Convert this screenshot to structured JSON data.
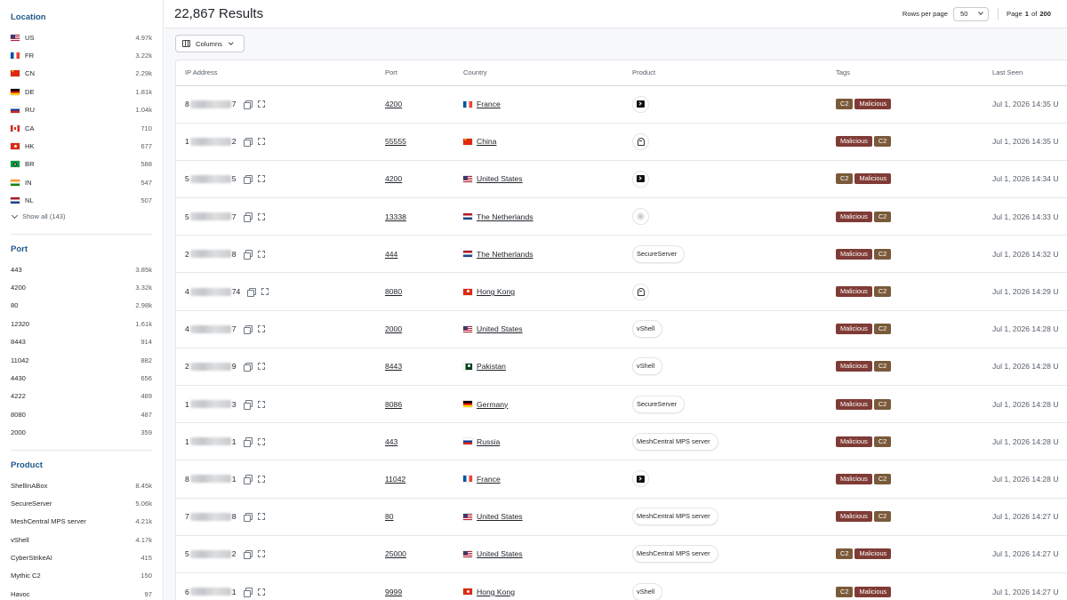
{
  "sidebar": {
    "location": {
      "title": "Location",
      "items": [
        {
          "flag": "us",
          "label": "US",
          "count": "4.97k"
        },
        {
          "flag": "fr",
          "label": "FR",
          "count": "3.22k"
        },
        {
          "flag": "cn",
          "label": "CN",
          "count": "2.29k"
        },
        {
          "flag": "de",
          "label": "DE",
          "count": "1.81k"
        },
        {
          "flag": "ru",
          "label": "RU",
          "count": "1.04k"
        },
        {
          "flag": "ca",
          "label": "CA",
          "count": "710"
        },
        {
          "flag": "hk",
          "label": "HK",
          "count": "677"
        },
        {
          "flag": "br",
          "label": "BR",
          "count": "588"
        },
        {
          "flag": "in",
          "label": "IN",
          "count": "547"
        },
        {
          "flag": "nl",
          "label": "NL",
          "count": "507"
        }
      ],
      "show_all": "Show all (143)"
    },
    "port": {
      "title": "Port",
      "items": [
        {
          "label": "443",
          "count": "3.85k"
        },
        {
          "label": "4200",
          "count": "3.32k"
        },
        {
          "label": "80",
          "count": "2.98k"
        },
        {
          "label": "12320",
          "count": "1.61k"
        },
        {
          "label": "8443",
          "count": "914"
        },
        {
          "label": "11042",
          "count": "882"
        },
        {
          "label": "4430",
          "count": "656"
        },
        {
          "label": "4222",
          "count": "489"
        },
        {
          "label": "8080",
          "count": "487"
        },
        {
          "label": "2000",
          "count": "359"
        }
      ]
    },
    "product": {
      "title": "Product",
      "items": [
        {
          "label": "ShellInABox",
          "count": "8.45k"
        },
        {
          "label": "SecureServer",
          "count": "5.06k"
        },
        {
          "label": "MeshCentral MPS server",
          "count": "4.21k"
        },
        {
          "label": "vShell",
          "count": "4.17k"
        },
        {
          "label": "CyberStrikeAI",
          "count": "415"
        },
        {
          "label": "Mythic C2",
          "count": "150"
        },
        {
          "label": "Havoc",
          "count": "97"
        }
      ]
    }
  },
  "header": {
    "results_title": "22,867 Results",
    "rows_per_page_label": "Rows per page",
    "rows_per_page_value": "50",
    "page_label": "Page",
    "page_current": "1",
    "page_of": "of",
    "page_total": "200"
  },
  "toolbar": {
    "columns_label": "Columns"
  },
  "table": {
    "columns": [
      "IP Address",
      "Port",
      "Country",
      "Product",
      "Tags",
      "Last Seen"
    ],
    "rows": [
      {
        "ip_start": "8",
        "ip_end": "7",
        "port": "4200",
        "flag": "fr",
        "country": "France",
        "product": "",
        "product_icon": "terminal-icon",
        "tags": [
          "C2",
          "Malicious"
        ],
        "last_seen": "Jul 1, 2026 14:35 U"
      },
      {
        "ip_start": "1",
        "ip_end": "2",
        "port": "55555",
        "flag": "cn",
        "country": "China",
        "product": "",
        "product_icon": "ghost-icon",
        "tags": [
          "Malicious",
          "C2"
        ],
        "last_seen": "Jul 1, 2026 14:35 U"
      },
      {
        "ip_start": "5",
        "ip_end": "5",
        "port": "4200",
        "flag": "us",
        "country": "United States",
        "product": "",
        "product_icon": "terminal-icon",
        "tags": [
          "C2",
          "Malicious"
        ],
        "last_seen": "Jul 1, 2026 14:34 U"
      },
      {
        "ip_start": "5",
        "ip_end": "7",
        "port": "13338",
        "flag": "nl",
        "country": "The Netherlands",
        "product": "",
        "product_icon": "bug-icon",
        "tags": [
          "Malicious",
          "C2"
        ],
        "last_seen": "Jul 1, 2026 14:33 U"
      },
      {
        "ip_start": "2",
        "ip_end": "8",
        "port": "444",
        "flag": "nl",
        "country": "The Netherlands",
        "product": "SecureServer",
        "product_icon": "",
        "tags": [
          "Malicious",
          "C2"
        ],
        "last_seen": "Jul 1, 2026 14:32 U"
      },
      {
        "ip_start": "4",
        "ip_end": "74",
        "port": "8080",
        "flag": "hk",
        "country": "Hong Kong",
        "product": "",
        "product_icon": "ghost-icon",
        "tags": [
          "Malicious",
          "C2"
        ],
        "last_seen": "Jul 1, 2026 14:29 U"
      },
      {
        "ip_start": "4",
        "ip_end": "7",
        "port": "2000",
        "flag": "us",
        "country": "United States",
        "product": "vShell",
        "product_icon": "",
        "tags": [
          "Malicious",
          "C2"
        ],
        "last_seen": "Jul 1, 2026 14:28 U"
      },
      {
        "ip_start": "2",
        "ip_end": "9",
        "port": "8443",
        "flag": "pk",
        "country": "Pakistan",
        "product": "vShell",
        "product_icon": "",
        "tags": [
          "Malicious",
          "C2"
        ],
        "last_seen": "Jul 1, 2026 14:28 U"
      },
      {
        "ip_start": "1",
        "ip_end": "3",
        "port": "8086",
        "flag": "de",
        "country": "Germany",
        "product": "SecureServer",
        "product_icon": "",
        "tags": [
          "Malicious",
          "C2"
        ],
        "last_seen": "Jul 1, 2026 14:28 U"
      },
      {
        "ip_start": "1",
        "ip_end": "1",
        "port": "443",
        "flag": "ru",
        "country": "Russia",
        "product": "MeshCentral MPS server",
        "product_icon": "",
        "tags": [
          "Malicious",
          "C2"
        ],
        "last_seen": "Jul 1, 2026 14:28 U"
      },
      {
        "ip_start": "8",
        "ip_end": "1",
        "port": "11042",
        "flag": "fr",
        "country": "France",
        "product": "",
        "product_icon": "terminal-icon",
        "tags": [
          "Malicious",
          "C2"
        ],
        "last_seen": "Jul 1, 2026 14:28 U"
      },
      {
        "ip_start": "7",
        "ip_end": "8",
        "port": "80",
        "flag": "us",
        "country": "United States",
        "product": "MeshCentral MPS server",
        "product_icon": "",
        "tags": [
          "Malicious",
          "C2"
        ],
        "last_seen": "Jul 1, 2026 14:27 U"
      },
      {
        "ip_start": "5",
        "ip_end": "2",
        "port": "25000",
        "flag": "us",
        "country": "United States",
        "product": "MeshCentral MPS server",
        "product_icon": "",
        "tags": [
          "C2",
          "Malicious"
        ],
        "last_seen": "Jul 1, 2026 14:27 U"
      },
      {
        "ip_start": "6",
        "ip_end": "1",
        "port": "9999",
        "flag": "hk",
        "country": "Hong Kong",
        "product": "vShell",
        "product_icon": "",
        "tags": [
          "C2",
          "Malicious"
        ],
        "last_seen": "Jul 1, 2026 14:27 U"
      }
    ]
  },
  "colors": {
    "facet_title": "#1f5a8a",
    "tag_c2": "#7a5a3a",
    "tag_malicious": "#7f3b35"
  }
}
